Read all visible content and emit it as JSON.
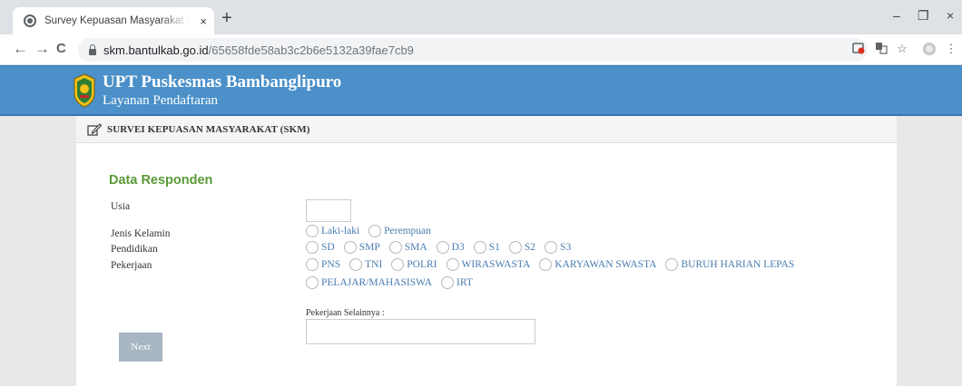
{
  "browser": {
    "tab_title": "Survey Kepuasan Masyarakat Kab",
    "tab_close": "×",
    "new_tab": "+",
    "minimize": "–",
    "restore": "❐",
    "close": "×",
    "back": "←",
    "forward": "→",
    "reload": "C",
    "url_host": "skm.bantulkab.go.id",
    "url_path": "/65658fde58ab3c2b6e5132a39fae7cb9",
    "star": "☆",
    "menu": "⋮"
  },
  "header": {
    "title": "UPT Puskesmas Bambanglipuro",
    "subtitle": "Layanan Pendaftaran"
  },
  "panel": {
    "title": "SURVEI KEPUASAN MASYARAKAT (SKM)"
  },
  "form": {
    "section_title": "Data Responden",
    "age_label": "Usia",
    "age_value": "",
    "gender_label": "Jenis Kelamin",
    "gender_options": [
      "Laki-laki",
      "Perempuan"
    ],
    "education_label": "Pendidikan",
    "education_options": [
      "SD",
      "SMP",
      "SMA",
      "D3",
      "S1",
      "S2",
      "S3"
    ],
    "job_label": "Pekerjaan",
    "job_options_row1": [
      "PNS",
      "TNI",
      "POLRI",
      "WIRASWASTA",
      "KARYAWAN SWASTA",
      "BURUH HARIAN LEPAS"
    ],
    "job_options_row2": [
      "PELAJAR/MAHASISWA",
      "IRT"
    ],
    "other_job_label": "Pekerjaan Selainnya :",
    "other_job_value": "",
    "next_label": "Next"
  },
  "colors": {
    "banner": "#4b90c8",
    "section_title": "#5a9a36",
    "option_text": "#4a7cb0",
    "next_button": "#a8b5c2"
  }
}
